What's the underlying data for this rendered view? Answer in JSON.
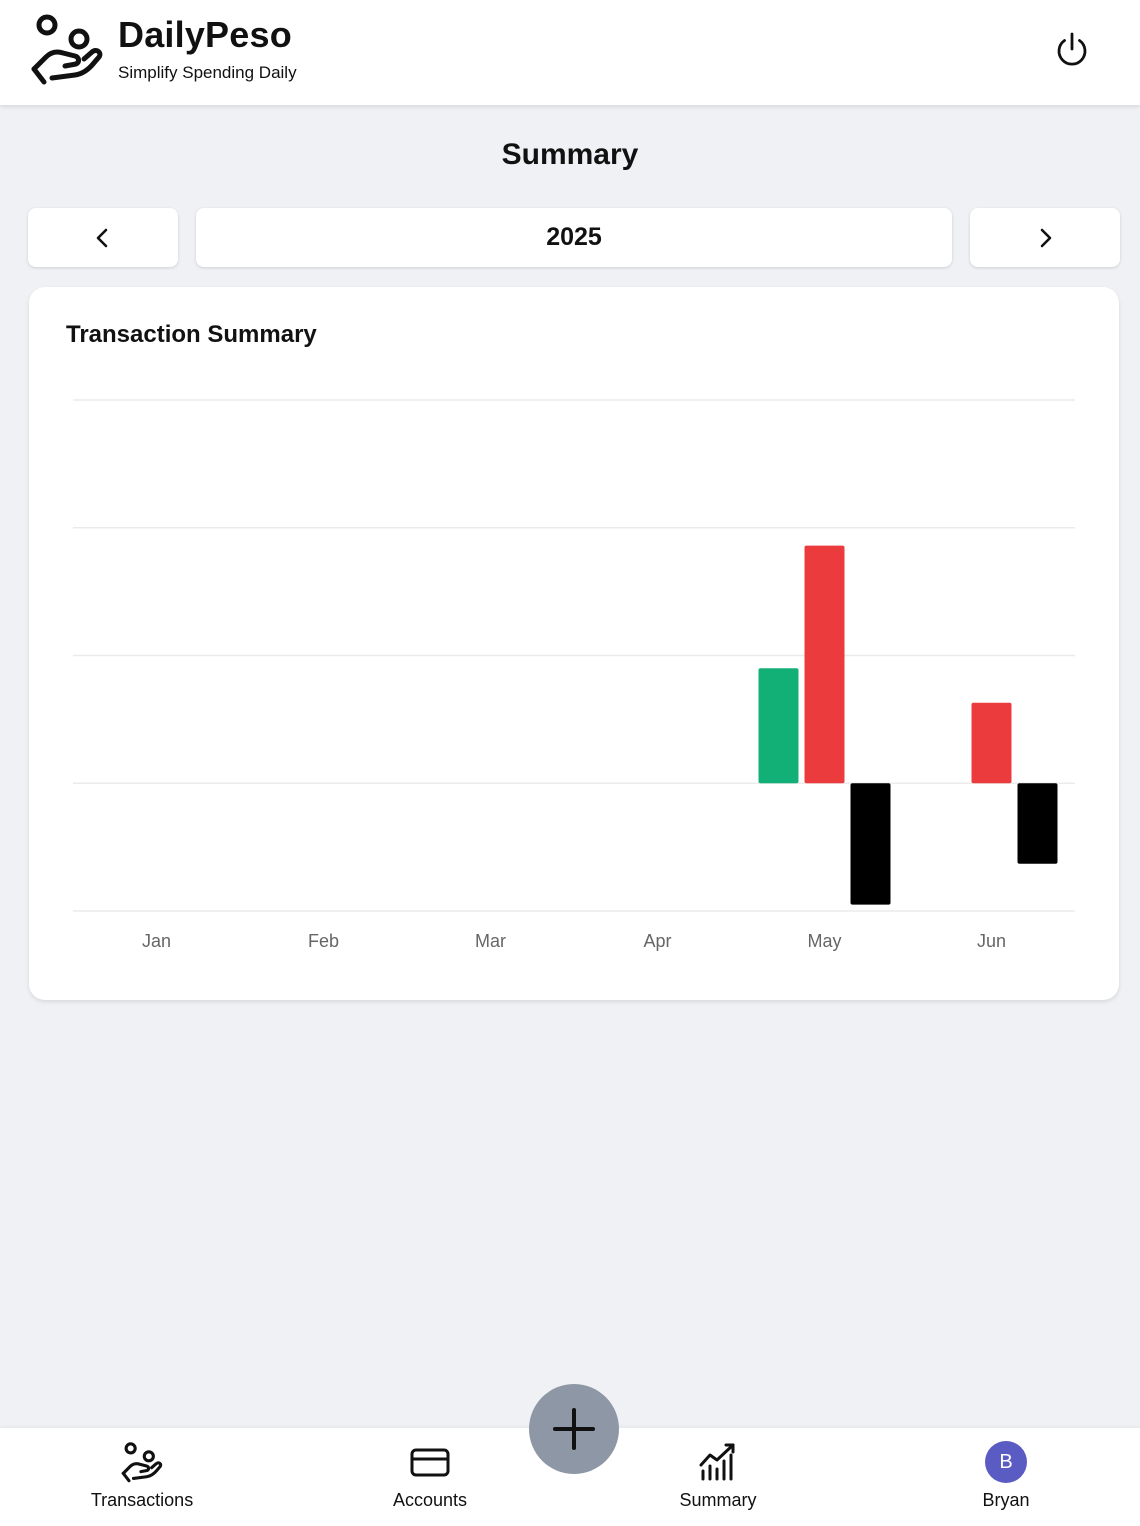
{
  "app": {
    "name": "DailyPeso",
    "tagline": "Simplify Spending Daily",
    "logo_icon": "hand-coins-icon",
    "power_icon": "power-icon"
  },
  "page": {
    "title": "Summary"
  },
  "year_nav": {
    "year": "2025",
    "prev_icon": "chevron-left-icon",
    "next_icon": "chevron-right-icon"
  },
  "card": {
    "title": "Transaction Summary"
  },
  "chart_data": {
    "type": "bar",
    "title": "Transaction Summary",
    "categories": [
      "Jan",
      "Feb",
      "Mar",
      "Apr",
      "May",
      "Jun"
    ],
    "ylim": [
      -1,
      3
    ],
    "grid": true,
    "legend": "none",
    "series": [
      {
        "color": "#12b076",
        "values": [
          0,
          0,
          0,
          0,
          0.9,
          0
        ]
      },
      {
        "color": "#ec3b3c",
        "values": [
          0,
          0,
          0,
          0,
          1.86,
          0.63
        ]
      },
      {
        "color": "#000000",
        "values": [
          0,
          0,
          0,
          0,
          -0.95,
          -0.63
        ]
      }
    ]
  },
  "bottom_nav": {
    "items": [
      {
        "label": "Transactions",
        "icon": "hand-coins-icon"
      },
      {
        "label": "Accounts",
        "icon": "credit-card-icon"
      },
      {
        "label": "Summary",
        "icon": "chart-icon"
      },
      {
        "label": "Bryan",
        "icon": "avatar",
        "initial": "B"
      }
    ],
    "fab_icon": "plus-icon"
  },
  "colors": {
    "background": "#f0f1f5",
    "income": "#12b076",
    "expense": "#ec3b3c",
    "net": "#000000",
    "fab": "#8e97a6",
    "avatar": "#5a5bc3"
  }
}
